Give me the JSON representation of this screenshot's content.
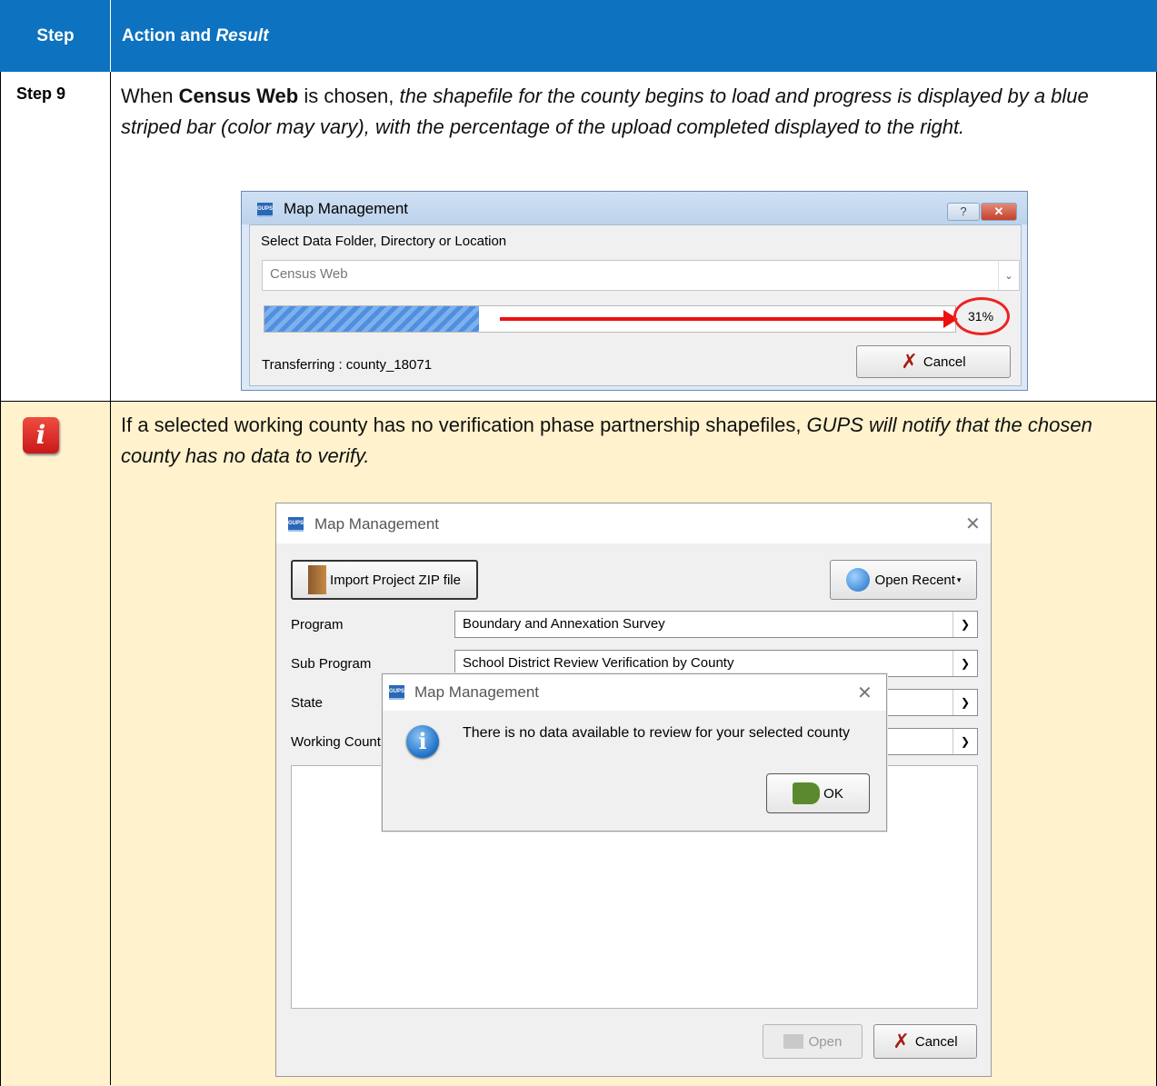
{
  "header": {
    "col1": "Step",
    "col2_plain": "Action and ",
    "col2_italic": "Result"
  },
  "step9": {
    "label": "Step 9",
    "text_1": "When ",
    "text_bold": "Census Web",
    "text_2": " is chosen, ",
    "text_italic": "the shapefile for the county begins to load and progress is displayed by a blue striped bar (color may vary), with the percentage of the upload completed displayed to the right."
  },
  "dialog1": {
    "app_icon": "GUPS",
    "title": "Map Management",
    "help_glyph": "?",
    "close_glyph": "✕",
    "prompt": "Select Data Folder, Directory or Location",
    "location_value": "Census Web",
    "progress_fraction": 0.31,
    "percent_text": "31%",
    "status_text": "Transferring : county_18071",
    "cancel_label": "Cancel",
    "cancel_icon": "x-cancel-icon"
  },
  "note": {
    "icon": "info-i-icon",
    "icon_glyph": "i",
    "text_plain": "If a selected working county has no verification phase partnership shapefiles, ",
    "text_italic": "GUPS will notify that the chosen county has no data to verify."
  },
  "dialog2": {
    "app_icon": "GUPS",
    "title": "Map Management",
    "import_label": "Import Project ZIP file",
    "open_recent_label": "Open Recent",
    "program_label": "Program",
    "program_value": "Boundary and Annexation Survey",
    "subprogram_label": "Sub Program",
    "subprogram_value": "School District Review Verification by County",
    "state_label": "State",
    "working_county_label": "Working Count",
    "open_label": "Open",
    "cancel_label": "Cancel"
  },
  "dialog3": {
    "app_icon": "GUPS",
    "title": "Map Management",
    "message": "There is no data available to review for your selected county",
    "ok_label": "OK"
  },
  "colors": {
    "header_bg": "#0d72bf",
    "note_bg": "#fff2cc",
    "accent_red": "#e11111"
  }
}
